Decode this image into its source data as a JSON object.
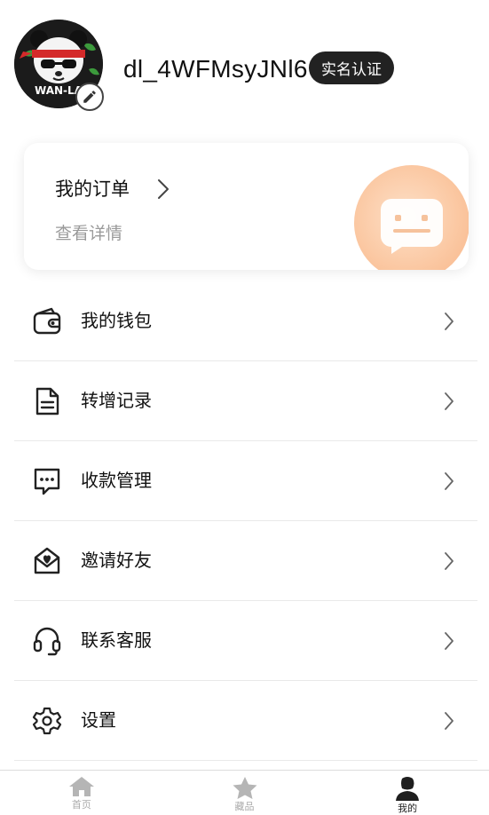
{
  "profile": {
    "username": "dl_4WFMsyJNl6",
    "verify_label": "实名认证",
    "avatar_text": "WAN-LA"
  },
  "order": {
    "title": "我的订单",
    "subtitle": "查看详情"
  },
  "menu": {
    "items": [
      {
        "label": "我的钱包",
        "icon": "wallet-icon"
      },
      {
        "label": "转增记录",
        "icon": "document-icon"
      },
      {
        "label": "收款管理",
        "icon": "message-icon"
      },
      {
        "label": "邀请好友",
        "icon": "invite-heart-icon"
      },
      {
        "label": "联系客服",
        "icon": "headset-icon"
      },
      {
        "label": "设置",
        "icon": "gear-icon"
      }
    ]
  },
  "nav": {
    "tabs": [
      {
        "label": "首页",
        "icon": "home-icon",
        "active": false
      },
      {
        "label": "藏品",
        "icon": "star-icon",
        "active": false
      },
      {
        "label": "我的",
        "icon": "user-icon",
        "active": true
      }
    ]
  },
  "colors": {
    "accent": "#222222",
    "card_deco": "#fbc9a4",
    "inactive_nav": "#aaaaaa",
    "divider": "#e9e9e9"
  }
}
